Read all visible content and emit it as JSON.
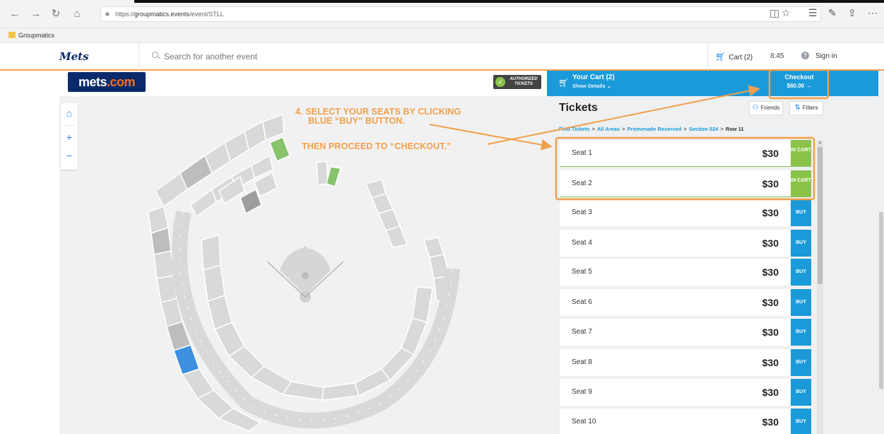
{
  "browser": {
    "url_prefix": "https://",
    "url_domain": "groupmatics.events",
    "url_path": "/event/STLL",
    "bookmark_label": "Groupmatics"
  },
  "header": {
    "brand_script": "Mets",
    "search_placeholder": "Search for another event",
    "cart_label": "Cart (2)",
    "timer": "8:45",
    "help": "?",
    "signin": "Sign in"
  },
  "map": {
    "logo_main": "mets",
    "logo_suffix": ".com",
    "auth_badge": "AUTHORIZED TICKETS",
    "zoom_in": "+",
    "zoom_out": "−"
  },
  "annotation": {
    "line1": "4. SELECT YOUR SEATS BY CLICKING",
    "line2": "BLUE “BUY” BUTTON.",
    "line3": "THEN PROCEED TO “CHECKOUT.”",
    "color": "#f0a04b"
  },
  "cart": {
    "title": "Your Cart (2)",
    "details": "Show Details",
    "checkout_label": "Checkout",
    "checkout_amount": "$60.00 →"
  },
  "tickets": {
    "title": "Tickets",
    "friends": "Friends",
    "filters": "Filters",
    "breadcrumb": [
      "Find Tickets",
      "All Areas",
      "Promenade Reserved",
      "Section 524",
      "Row 11"
    ],
    "seats": [
      {
        "name": "Seat 1",
        "price": "$30",
        "status": "IN CART"
      },
      {
        "name": "Seat 2",
        "price": "$30",
        "status": "IN CART"
      },
      {
        "name": "Seat 3",
        "price": "$30",
        "status": "BUY"
      },
      {
        "name": "Seat 4",
        "price": "$30",
        "status": "BUY"
      },
      {
        "name": "Seat 5",
        "price": "$30",
        "status": "BUY"
      },
      {
        "name": "Seat 6",
        "price": "$30",
        "status": "BUY"
      },
      {
        "name": "Seat 7",
        "price": "$30",
        "status": "BUY"
      },
      {
        "name": "Seat 8",
        "price": "$30",
        "status": "BUY"
      },
      {
        "name": "Seat 9",
        "price": "$30",
        "status": "BUY"
      },
      {
        "name": "Seat 10",
        "price": "$30",
        "status": "BUY"
      }
    ]
  },
  "colors": {
    "accent_blue": "#1a9ad9",
    "in_cart_green": "#8bc34a",
    "annotation_orange": "#f0a04b",
    "mets_navy": "#0a2a6b",
    "mets_orange": "#f37021"
  }
}
